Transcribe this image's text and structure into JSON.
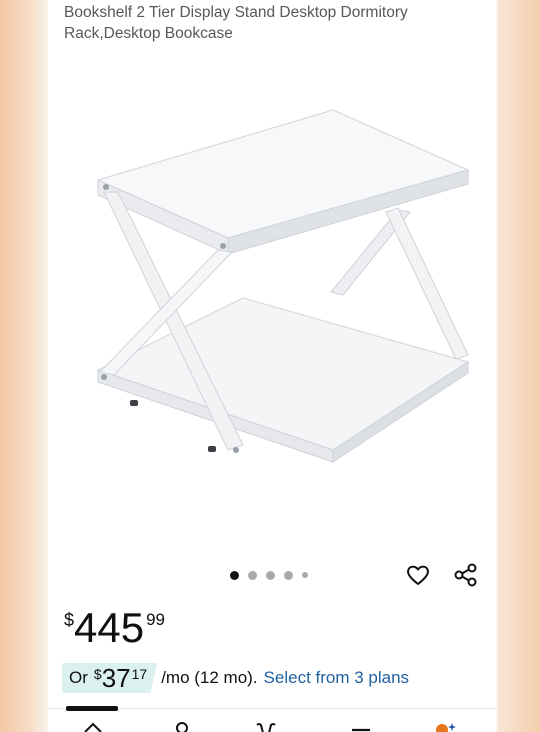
{
  "product": {
    "title": "Bookshelf 2 Tier Display Stand Desktop Dormitory Rack,Desktop Bookcase"
  },
  "gallery": {
    "total_images": 5,
    "active_index": 0
  },
  "price": {
    "symbol": "$",
    "whole": "445",
    "fraction": "99"
  },
  "installments": {
    "prefix": "Or",
    "symbol": "$",
    "whole": "37",
    "fraction": "17",
    "term": "/mo (12 mo).",
    "link": "Select from 3 plans"
  },
  "icons": {
    "wishlist": "heart-icon",
    "share": "share-icon",
    "nav": [
      "home-icon",
      "profile-icon",
      "cart-icon",
      "menu-icon",
      "ai-assistant-icon"
    ]
  },
  "colors": {
    "link": "#2162a1",
    "chip_background": "#dbf1ef",
    "active_dot": "#111111",
    "inactive_dot": "#a7a9ab",
    "assistant_accent": "#e8751a"
  }
}
